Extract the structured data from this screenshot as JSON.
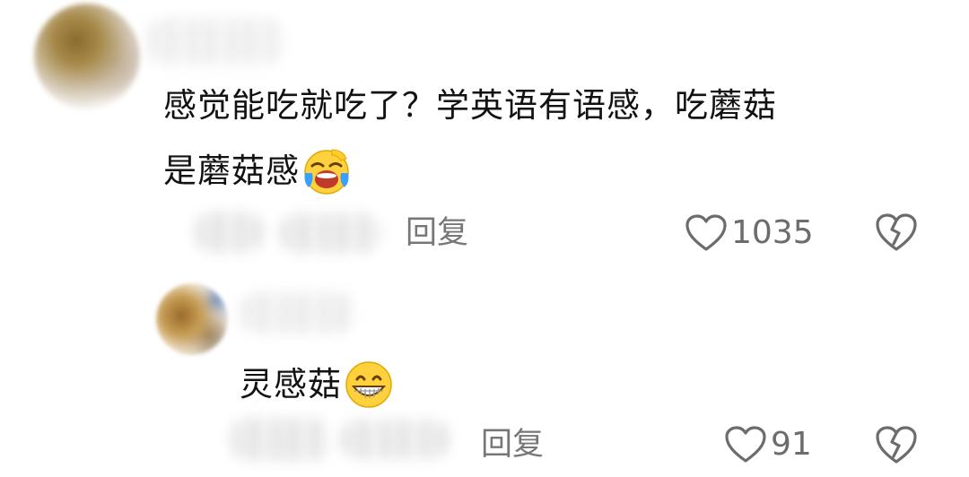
{
  "comment": {
    "text_line1": "感觉能吃就吃了？学英语有语感，吃蘑菇",
    "text_line2": "是蘑菇感",
    "reply_label": "回复",
    "like_count": "1035",
    "emoji": "laughing-crying-emoji"
  },
  "reply": {
    "text": "灵感菇",
    "reply_label": "回复",
    "like_count": "91",
    "emoji": "grinning-emoji"
  },
  "icons": {
    "like": "heart-outline-icon",
    "dislike": "broken-heart-icon"
  },
  "colors": {
    "text": "#121212",
    "meta": "#777777",
    "icon": "#6c6c6c",
    "emoji_yellow": "#ffd23d"
  }
}
